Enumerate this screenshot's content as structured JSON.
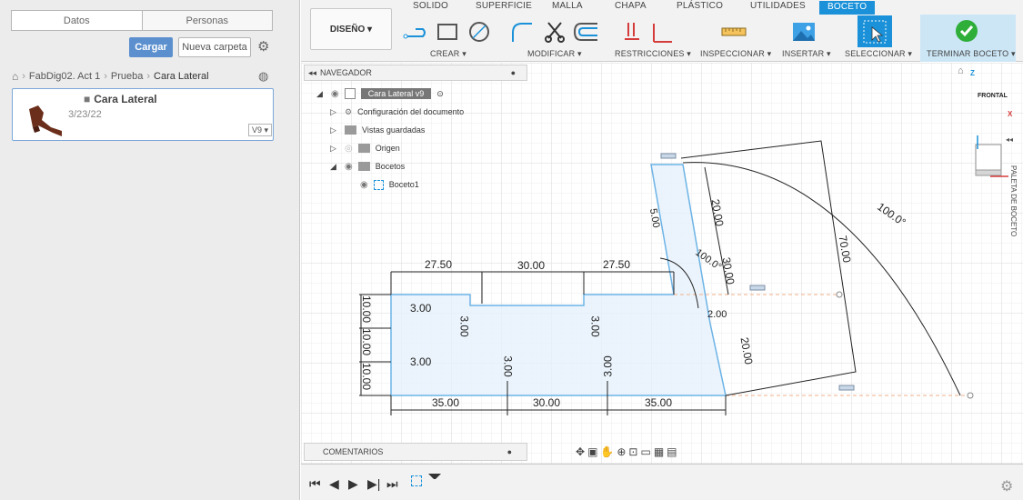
{
  "left_panel": {
    "tabs": [
      "Datos",
      "Personas"
    ],
    "buttons": {
      "cargar": "Cargar",
      "nueva_carpeta": "Nueva carpeta"
    },
    "breadcrumb": [
      "FabDig02. Act 1",
      "Prueba",
      "Cara Lateral"
    ],
    "file": {
      "name": "Cara Lateral",
      "date": "3/23/22",
      "version": "V9 ▾"
    }
  },
  "toolbar": {
    "workspace_tabs": [
      "SOLIDO",
      "SUPERFICIE",
      "MALLA",
      "CHAPA",
      "PLÁSTICO",
      "UTILIDADES",
      "BOCETO"
    ],
    "active_tab": "BOCETO",
    "diseno": "DISEÑO ▾",
    "groups": [
      "CREAR ▾",
      "MODIFICAR ▾",
      "RESTRICCIONES ▾",
      "INSPECCIONAR ▾",
      "INSERTAR ▾",
      "SELECCIONAR ▾",
      "TERMINAR BOCETO ▾"
    ],
    "accent": "#1a91d8",
    "finish_color": "#2fae3a"
  },
  "browser": {
    "header": "NAVEGADOR",
    "root": "Cara Lateral v9",
    "items": [
      "Configuración del documento",
      "Vistas guardadas",
      "Origen",
      "Bocetos",
      "Boceto1"
    ]
  },
  "viewcube": {
    "face": "FRONTAL",
    "axes": [
      "Z",
      "X"
    ]
  },
  "palette": "PALETA DE BOCETO",
  "comments": "COMENTARIOS",
  "sketch": {
    "dims_top": [
      "27.50",
      "30.00",
      "27.50"
    ],
    "dims_bottom": [
      "35.00",
      "30.00",
      "35.00"
    ],
    "dims_left": [
      "10.00",
      "10.00",
      "10.00"
    ],
    "dims_small": [
      "3.00",
      "3.00",
      "3.00",
      "3.00",
      "3.00",
      "3.00",
      "3.00",
      "3.00"
    ],
    "dims_right": [
      "20.00",
      "30.00",
      "20.00",
      "70.00",
      "5.00",
      "2.00"
    ],
    "angles": [
      "100.0°",
      "100.0°"
    ]
  }
}
